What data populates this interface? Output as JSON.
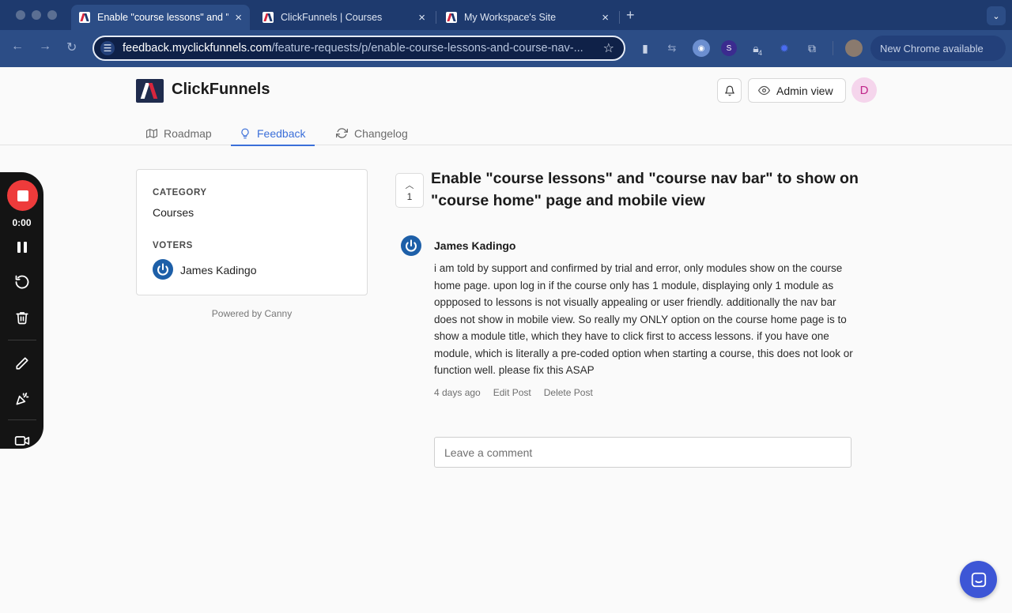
{
  "browser": {
    "tabs": [
      {
        "title": "Enable \"course lessons\" and \"course nav bar\" to show on",
        "active": true
      },
      {
        "title": "ClickFunnels | Courses",
        "active": false
      },
      {
        "title": "My Workspace's Site",
        "active": false
      }
    ],
    "new_tab_symbol": "+",
    "tab_menu_symbol": "⌄",
    "url_domain": "feedback.myclickfunnels.com",
    "url_path": "/feature-requests/p/enable-course-lessons-and-course-nav-...",
    "extension_badge": "4",
    "extension_s_letter": "S",
    "update_label": "New Chrome available",
    "colors": {
      "frame": "#1e3a6e",
      "toolbar": "#2c4d86"
    }
  },
  "header": {
    "brand": "ClickFunnels",
    "admin_label": "Admin view",
    "avatar_initial": "D",
    "tabs": [
      {
        "label": "Roadmap",
        "icon": "map-icon"
      },
      {
        "label": "Feedback",
        "icon": "lightbulb-icon",
        "active": true
      },
      {
        "label": "Changelog",
        "icon": "refresh-icon"
      }
    ]
  },
  "sidebar": {
    "category_label": "CATEGORY",
    "category_value": "Courses",
    "voters_label": "VOTERS",
    "voters": [
      {
        "name": "James Kadingo"
      }
    ],
    "powered_by": "Powered by Canny"
  },
  "post": {
    "vote_count": "1",
    "title": "Enable \"course lessons\" and \"course nav bar\" to show on \"course home\" page and mobile view",
    "author": "James Kadingo",
    "body": "i am told by support and confirmed by trial and error, only modules show on the course home page. upon log in if the course only has 1 module, displaying only 1 module as oppposed to lessons is not visually appealing or user friendly. additionally the nav bar does not show in mobile view. So really my ONLY option on the course home page is to show a module title, which they have to click first to access lessons. if you have one module, which is literally a pre-coded option when starting a course, this does not look or function well. please fix this ASAP",
    "time": "4 days ago",
    "edit_label": "Edit Post",
    "delete_label": "Delete Post",
    "comment_placeholder": "Leave a comment"
  },
  "recorder": {
    "time": "0:00",
    "colors": {
      "stop": "#ee3b3b",
      "panel": "#141414"
    }
  },
  "colors": {
    "accent": "#3b6fd9",
    "avatar_blue": "#1d5fa8",
    "chat": "#3d56d6"
  }
}
